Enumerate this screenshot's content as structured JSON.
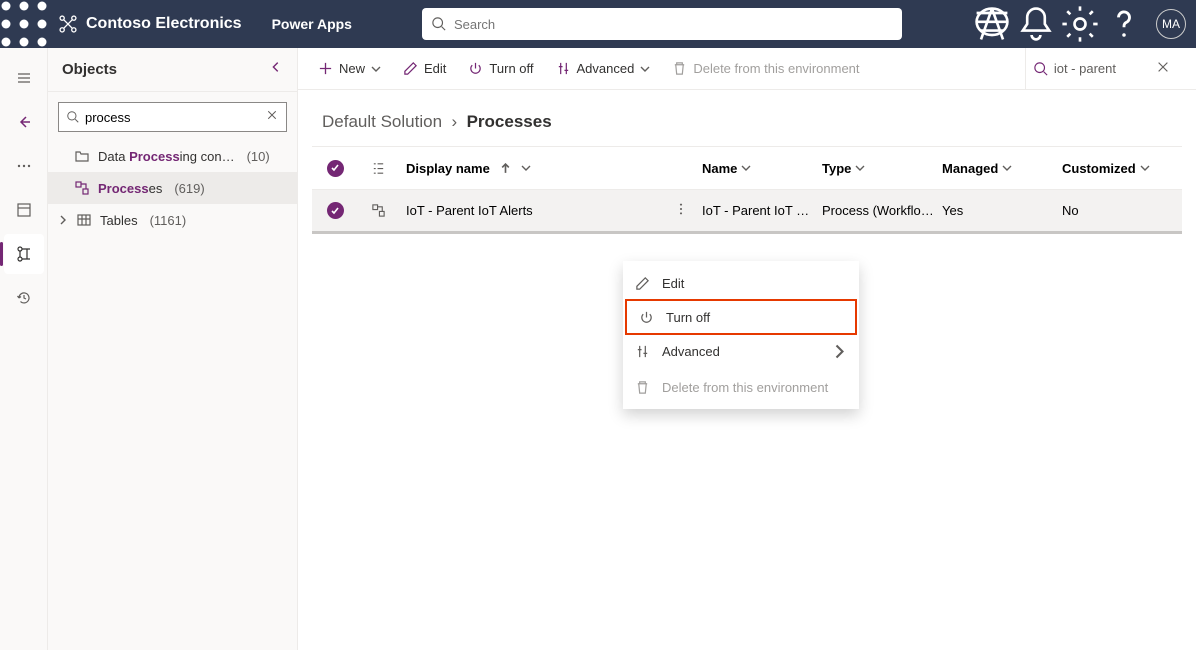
{
  "header": {
    "brand": "Contoso Electronics",
    "app": "Power Apps",
    "search_placeholder": "Search",
    "avatar": "MA"
  },
  "objects": {
    "title": "Objects",
    "search_value": "process",
    "items": [
      {
        "label_pre": "Data ",
        "label_hl": "Process",
        "label_post": "ing con…",
        "count": "(10)"
      },
      {
        "label_pre": "",
        "label_hl": "Process",
        "label_post": "es",
        "count": "(619)"
      },
      {
        "label_pre": "Tables",
        "label_hl": "",
        "label_post": "",
        "count": "(1161)"
      }
    ]
  },
  "toolbar": {
    "new": "New",
    "edit": "Edit",
    "turnoff": "Turn off",
    "advanced": "Advanced",
    "delete": "Delete from this environment",
    "filter": "iot - parent"
  },
  "crumbs": {
    "parent": "Default Solution",
    "current": "Processes"
  },
  "grid": {
    "cols": {
      "display": "Display name",
      "name": "Name",
      "type": "Type",
      "managed": "Managed",
      "custom": "Customized"
    },
    "rows": [
      {
        "display": "IoT - Parent IoT Alerts",
        "name": "IoT - Parent IoT …",
        "type": "Process (Workflo…",
        "managed": "Yes",
        "custom": "No"
      }
    ]
  },
  "ctx": {
    "edit": "Edit",
    "turnoff": "Turn off",
    "advanced": "Advanced",
    "delete": "Delete from this environment"
  }
}
